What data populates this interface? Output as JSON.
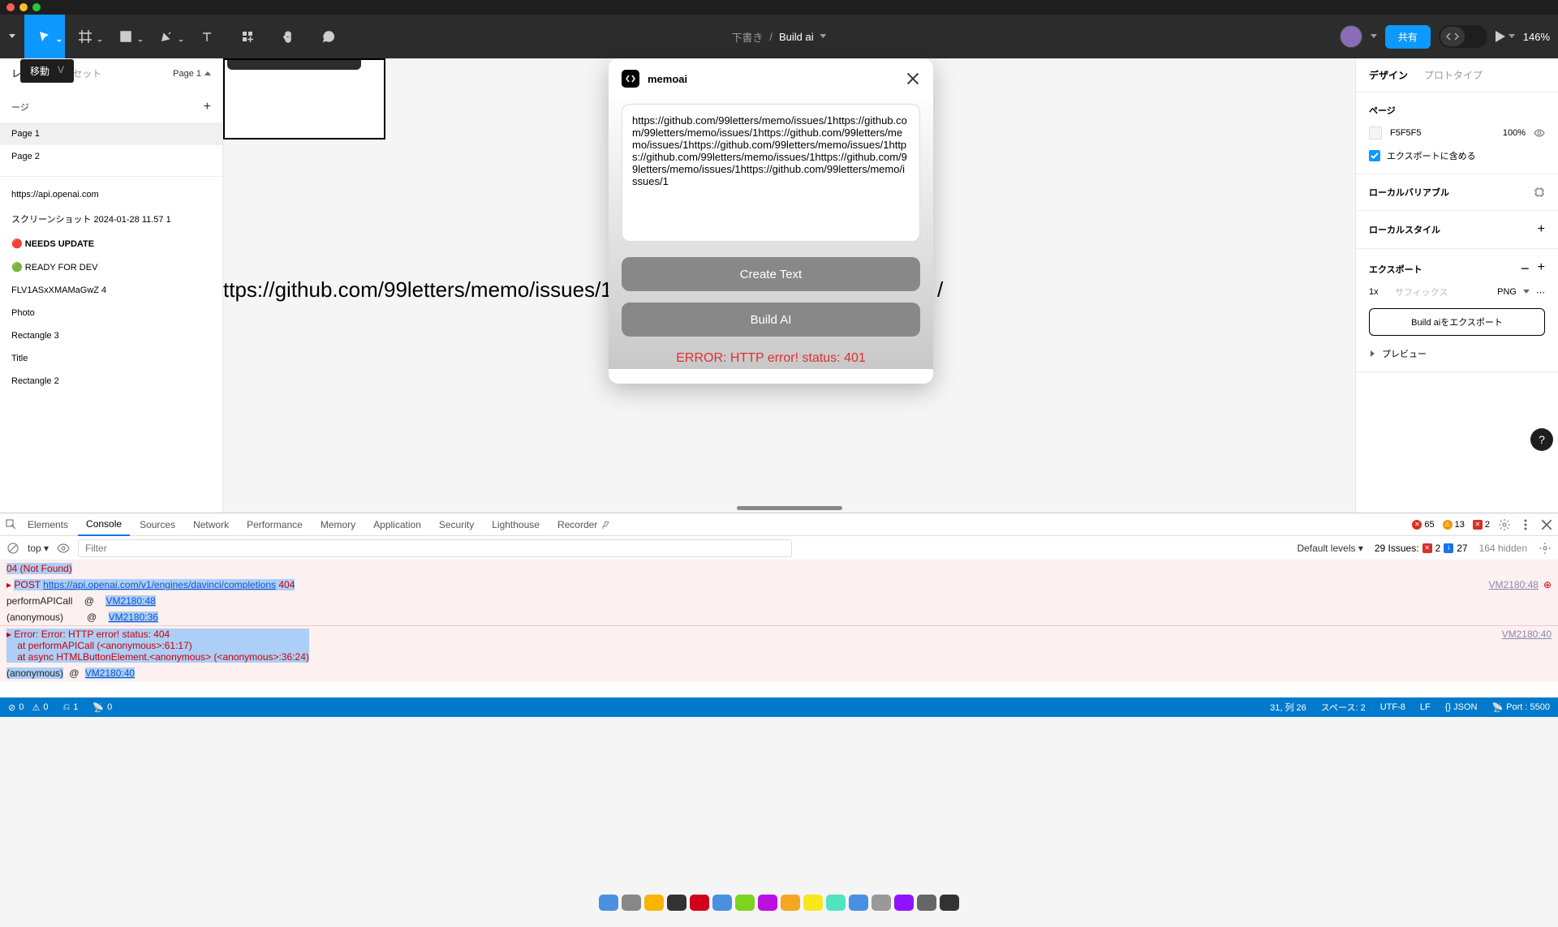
{
  "toolbar": {
    "draft_label": "下書き",
    "project_name": "Build ai",
    "share_button": "共有",
    "zoom": "146%",
    "tooltip_label": "移動",
    "tooltip_shortcut": "V"
  },
  "left_panel": {
    "tabs": [
      "レイヤー",
      "アセット"
    ],
    "page_selector": "Page 1",
    "pages_header": "ージ",
    "pages": [
      "Page 1",
      "Page 2"
    ],
    "layers": [
      "https://api.openai.com",
      "スクリーンショット 2024-01-28 11.57 1",
      "🔴 NEEDS UPDATE",
      "🟢 READY FOR DEV",
      "FLV1ASxXMAMaGwZ 4",
      "Photo",
      "Rectangle 3",
      "Title",
      "Rectangle 2"
    ]
  },
  "canvas": {
    "text": "ttps://github.com/99letters/memo/issues/1https://g",
    "text_right": "/"
  },
  "plugin": {
    "title": "memoai",
    "textarea_value": "https://github.com/99letters/memo/issues/1https://github.com/99letters/memo/issues/1https://github.com/99letters/memo/issues/1https://github.com/99letters/memo/issues/1https://github.com/99letters/memo/issues/1https://github.com/99letters/memo/issues/1https://github.com/99letters/memo/issues/1",
    "btn_create": "Create Text",
    "btn_build": "Build AI",
    "error": "ERROR: HTTP error! status: 401"
  },
  "right_panel": {
    "tabs": [
      "デザイン",
      "プロトタイプ"
    ],
    "page_section": "ページ",
    "bg_color": "F5F5F5",
    "bg_opacity": "100%",
    "export_include": "エクスポートに含める",
    "local_vars": "ローカルバリアブル",
    "local_styles": "ローカルスタイル",
    "export_title": "エクスポート",
    "export_scale": "1x",
    "export_suffix_placeholder": "サフィックス",
    "export_format": "PNG",
    "export_button": "Build aiをエクスポート",
    "preview": "プレビュー"
  },
  "devtools": {
    "tabs": [
      "Elements",
      "Console",
      "Sources",
      "Network",
      "Performance",
      "Memory",
      "Application",
      "Security",
      "Lighthouse",
      "Recorder"
    ],
    "err_count": "65",
    "warn_count": "13",
    "info_count": "2",
    "filter_top": "top",
    "filter_placeholder": "Filter",
    "default_levels": "Default levels",
    "issues_label": "29 Issues:",
    "issues_red": "2",
    "issues_blue": "27",
    "hidden": "164 hidden",
    "rows": {
      "r0_notfound": "04 (Not Found)",
      "r1_method": "POST",
      "r1_url": "https://api.openai.com/v1/engines/davinci/completions",
      "r1_status": "404",
      "r1_src": "VM2180:48",
      "r2_fn": "performAPICall",
      "r2_at": "@",
      "r2_src": "VM2180:48",
      "r3_fn": "(anonymous)",
      "r3_at": "@",
      "r3_src": "VM2180:36",
      "r4_l1": "Error: Error: HTTP error! status: 404",
      "r4_l2": "    at performAPICall (<anonymous>:61:17)",
      "r4_l3": "    at async HTMLButtonElement.<anonymous> (<anonymous>:36:24)",
      "r4_src": "VM2180:40",
      "r5_fn": "(anonymous)",
      "r5_at": "@",
      "r5_src": "VM2180:40"
    }
  },
  "statusbar": {
    "err": "0",
    "warn": "0",
    "git": "1",
    "radio": "0",
    "cursor": "31, 列 26",
    "spaces": "スペース: 2",
    "encoding": "UTF-8",
    "eol": "LF",
    "lang": "{} JSON",
    "port": "Port : 5500"
  },
  "dock_colors": [
    "#4a90e2",
    "#888",
    "#f7b500",
    "#333",
    "#d0021b",
    "#4a90e2",
    "#7ed321",
    "#bd10e0",
    "#f5a623",
    "#f8e71c",
    "#50e3c2",
    "#4a90e2",
    "#999",
    "#9013fe",
    "#666",
    "#333"
  ]
}
